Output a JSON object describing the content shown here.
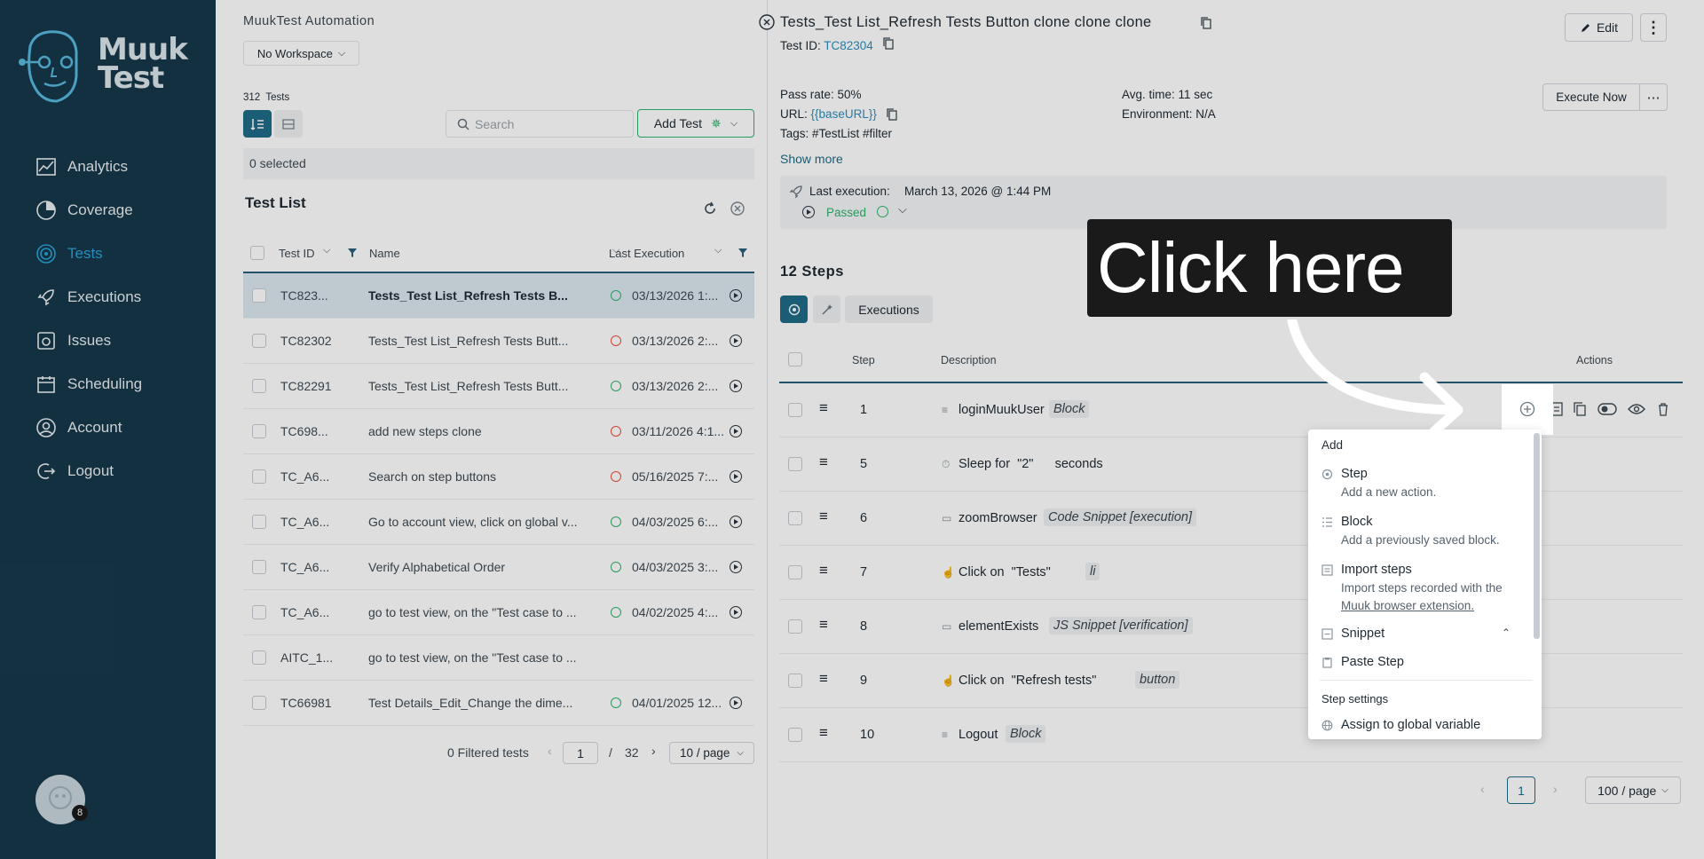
{
  "sidebar": {
    "logo_text": "Muuk Test",
    "items": [
      {
        "label": "Analytics",
        "icon": "analytics-icon"
      },
      {
        "label": "Coverage",
        "icon": "coverage-icon"
      },
      {
        "label": "Tests",
        "icon": "tests-icon"
      },
      {
        "label": "Executions",
        "icon": "executions-icon"
      },
      {
        "label": "Issues",
        "icon": "issues-icon"
      },
      {
        "label": "Scheduling",
        "icon": "scheduling-icon"
      },
      {
        "label": "Account",
        "icon": "account-icon"
      },
      {
        "label": "Logout",
        "icon": "logout-icon"
      }
    ],
    "avatar_badge": "8"
  },
  "list": {
    "app_title": "MuukTest Automation",
    "workspace": "No Workspace",
    "tests_count": "312",
    "tests_label": "Tests",
    "search_placeholder": "Search",
    "add_test": "Add Test",
    "selected": "0 selected",
    "title": "Test List",
    "columns": [
      "Test ID",
      "Name",
      "Last Execution"
    ],
    "rows": [
      {
        "id": "TC823...",
        "name": "Tests_Test List_Refresh Tests B...",
        "date": "03/13/2026 1:...",
        "status": "pass",
        "selected": true
      },
      {
        "id": "TC82302",
        "name": "Tests_Test List_Refresh Tests Butt...",
        "date": "03/13/2026 2:...",
        "status": "fail"
      },
      {
        "id": "TC82291",
        "name": "Tests_Test List_Refresh Tests Butt...",
        "date": "03/13/2026 2:...",
        "status": "pass"
      },
      {
        "id": "TC698...",
        "name": "add new steps clone",
        "date": "03/11/2026 4:1...",
        "status": "fail"
      },
      {
        "id": "TC_A6...",
        "name": "Search on step buttons",
        "date": "05/16/2025 7:...",
        "status": "fail"
      },
      {
        "id": "TC_A6...",
        "name": "Go to account view, click on global v...",
        "date": "04/03/2025 6:...",
        "status": "pass"
      },
      {
        "id": "TC_A6...",
        "name": "Verify Alphabetical Order",
        "date": "04/03/2025 3:...",
        "status": "pass"
      },
      {
        "id": "TC_A6...",
        "name": "go to test view, on the \"Test case to ...",
        "date": "04/02/2025 4:...",
        "status": "pass"
      },
      {
        "id": "AITC_1...",
        "name": "go to test view, on the \"Test case to ...",
        "date": "",
        "status": "none"
      },
      {
        "id": "TC66981",
        "name": "Test Details_Edit_Change the dime...",
        "date": "04/01/2025 12...",
        "status": "pass"
      }
    ],
    "filtered": "0 Filtered tests",
    "page": "1",
    "page_sep": "/",
    "page_total": "32",
    "page_size": "10 / page"
  },
  "detail": {
    "title": "Tests_Test List_Refresh Tests Button clone clone clone",
    "test_id_label": "Test ID:",
    "test_id": "TC82304",
    "edit": "Edit",
    "pass_rate": "Pass rate: 50%",
    "url_label": "URL:",
    "url_value": "{{baseURL}}",
    "tags": "Tags: #TestList #filter",
    "avg_time": "Avg. time: 11 sec",
    "environment": "Environment: N/A",
    "execute_now": "Execute Now",
    "show_more": "Show more",
    "last_exec_label": "Last execution:",
    "last_exec_value": "March 13, 2026 @ 1:44 PM",
    "passed": "Passed",
    "steps_title": "12 Steps",
    "executions_tab": "Executions",
    "col_step": "Step",
    "col_description": "Description",
    "col_actions": "Actions",
    "steps": [
      {
        "num": "1",
        "text": "loginMuukUser",
        "tag": "Block",
        "icon": "block-icon"
      },
      {
        "num": "5",
        "text": "Sleep for  \"2\"      seconds",
        "tag": "",
        "icon": "clock-icon"
      },
      {
        "num": "6",
        "text": "zoomBrowser",
        "tag": "Code Snippet [execution]",
        "icon": "snippet-icon"
      },
      {
        "num": "7",
        "text": "Click on  \"Tests\"",
        "tag": "li",
        "icon": "click-icon"
      },
      {
        "num": "8",
        "text": "elementExists",
        "tag": "JS Snippet [verification]",
        "icon": "snippet-icon"
      },
      {
        "num": "9",
        "text": "Click on  \"Refresh tests\"",
        "tag": "button",
        "icon": "click-icon"
      },
      {
        "num": "10",
        "text": "Logout",
        "tag": "Block",
        "icon": "block-icon"
      }
    ],
    "steps_page": "1",
    "steps_page_size": "100 / page"
  },
  "add_menu": {
    "header": "Add",
    "items": [
      {
        "label": "Step",
        "sub": "Add a new action."
      },
      {
        "label": "Block",
        "sub": "Add a previously saved block."
      },
      {
        "label": "Import steps",
        "sub": "Import steps recorded with the",
        "link": "Muuk browser extension."
      },
      {
        "label": "Snippet",
        "sub": ""
      },
      {
        "label": "Paste Step",
        "sub": ""
      }
    ],
    "settings_header": "Step settings",
    "settings_item": "Assign to global variable"
  },
  "callout": {
    "text": "Click here"
  },
  "colors": {
    "sidebar_bg": "#16384a",
    "accent": "#2aa3d8",
    "teal_button": "#1f6b86",
    "pass": "#2fb36b",
    "fail": "#e8503a"
  }
}
